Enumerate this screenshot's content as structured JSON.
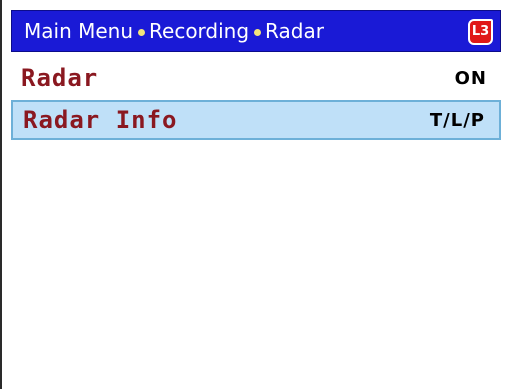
{
  "header": {
    "crumbs": [
      "Main Menu",
      "Recording",
      "Radar"
    ],
    "badge": "L3",
    "badge_icon": "L3-logo-icon",
    "colors": {
      "bar": "#1a1ad6",
      "separator": "#f1e37a",
      "badge": "#e01818"
    }
  },
  "menu": {
    "items": [
      {
        "label": "Radar",
        "value": "ON",
        "selected": false
      },
      {
        "label": "Radar Info",
        "value": "T/L/P",
        "selected": true
      }
    ],
    "colors": {
      "label": "#8a1820",
      "selected_bg": "#bfe0f8"
    }
  }
}
